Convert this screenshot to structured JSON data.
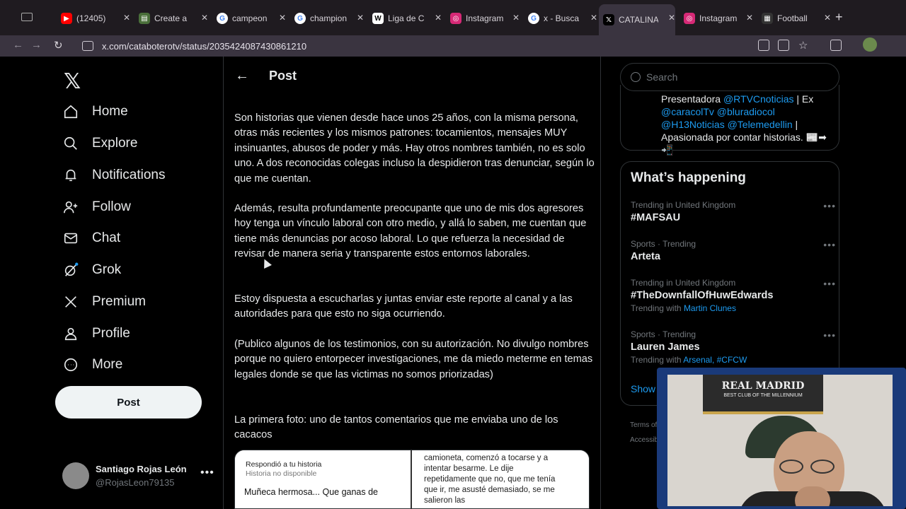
{
  "browser": {
    "tabs": [
      {
        "title": "(12405)",
        "icon": "youtube-icon",
        "color": "#ff0000"
      },
      {
        "title": "Create a",
        "icon": "app-icon",
        "color": "#4a6f3a"
      },
      {
        "title": "campeon",
        "icon": "google-icon",
        "color": "#ffffff"
      },
      {
        "title": "champion",
        "icon": "google-icon",
        "color": "#ffffff"
      },
      {
        "title": "Liga de C",
        "icon": "wikipedia-icon",
        "color": "#ffffff"
      },
      {
        "title": "Instagram",
        "icon": "instagram-icon",
        "color": "#d62976"
      },
      {
        "title": "x - Busca",
        "icon": "google-icon",
        "color": "#ffffff"
      },
      {
        "title": "CATALINA",
        "icon": "x-icon",
        "color": "#000000"
      },
      {
        "title": "Instagram",
        "icon": "instagram-icon",
        "color": "#d62976"
      },
      {
        "title": "Football",
        "icon": "app-icon",
        "color": "#333333"
      }
    ],
    "url": "x.com/cataboterotv/status/2035424087430861210"
  },
  "nav": {
    "items": [
      "Home",
      "Explore",
      "Notifications",
      "Follow",
      "Chat",
      "Grok",
      "Premium",
      "Profile",
      "More"
    ],
    "post_label": "Post",
    "account": {
      "name": "Santiago Rojas León",
      "handle": "@RojasLeon79135"
    }
  },
  "main": {
    "title": "Post",
    "paragraphs": [
      "Son historias que vienen desde hace unos 25 años, con la misma persona, otras más recientes y los mismos patrones: tocamientos, mensajes MUY insinuantes, abusos de poder y más. Hay otros nombres también, no es solo uno. A dos reconocidas colegas incluso la despidieron tras denunciar, según lo que me cuentan.",
      "Además, resulta profundamente preocupante que uno de mis dos agresores hoy tenga un vínculo laboral con otro medio, y allá lo saben, me cuentan que tiene más denuncias por acoso laboral. Lo que refuerza la necesidad de revisar de manera seria y transparente estos entornos laborales.",
      "Estoy dispuesta a escucharlas y juntas enviar este reporte al canal y a las autoridades para que esto no siga ocurriendo.",
      "(Publico algunos de los testimonios, con su autorización. No divulgo nombres porque no quiero entorpecer investigaciones, me da miedo meterme en temas legales donde se que las victimas no somos priorizadas)",
      "La primera foto: uno de tantos comentarios que me enviaba uno de los cacacos"
    ],
    "media": {
      "left_line1": "Respondió a tu historia",
      "left_line2": "Historia no disponible",
      "left_line3": "Muñeca hermosa... Que ganas de",
      "right_text": "camioneta, comenzó a tocarse y a intentar besarme. Le dije repetidamente que no, que me tenía que ir, me asusté demasiado, se me salieron las"
    }
  },
  "sidebar": {
    "search_placeholder": "Search",
    "bio": {
      "pre": "Presentadora ",
      "link1": "@RTVCnoticias",
      "mid1": " | Ex ",
      "link2": "@caracolTv",
      "sp1": " ",
      "link3": "@bluradiocol",
      "sp2": " ",
      "link4": "@H13Noticias",
      "sp3": " ",
      "link5": "@Telemedellin",
      "post": " | Apasionada por contar historias. 📰➡📲"
    },
    "happening_title": "What’s happening",
    "trends": [
      {
        "context": "Trending in United Kingdom",
        "name": "#MAFSAU",
        "with": "",
        "with_links": ""
      },
      {
        "context": "Sports · Trending",
        "name": "Arteta",
        "with": "",
        "with_links": ""
      },
      {
        "context": "Trending in United Kingdom",
        "name": "#TheDownfallOfHuwEdwards",
        "with": "Trending with ",
        "with_links": "Martin Clunes"
      },
      {
        "context": "Sports · Trending",
        "name": "Lauren James",
        "with": "Trending with ",
        "with_links": "Arsenal, #CFCW"
      }
    ],
    "show_more": "Show m",
    "footer1": "Terms of S",
    "footer2": "Accessibi"
  },
  "webcam": {
    "scarf_text": "REAL MADRID",
    "scarf_sub": "BEST CLUB OF THE MILLENNIUM"
  }
}
